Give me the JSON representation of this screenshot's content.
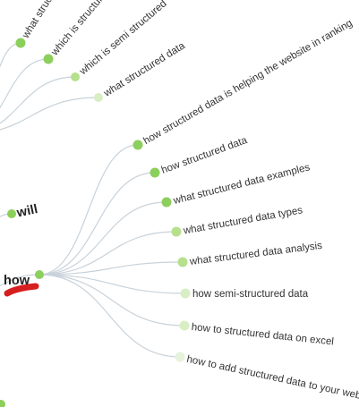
{
  "colors": {
    "node_strong": "#8ccf5c",
    "node_mid": "#b6e08c",
    "node_light": "#d8eec4",
    "node_faint": "#e6f2db",
    "link": "#c8d2da",
    "highlight": "#d61f1f"
  },
  "top_branch": {
    "leaves": [
      {
        "label": "what structured",
        "shade": "strong"
      },
      {
        "label": "which is structured",
        "shade": "strong"
      },
      {
        "label": "which is semi structured",
        "shade": "mid"
      },
      {
        "label": "what structured data",
        "shade": "light"
      }
    ]
  },
  "hubs": {
    "will": {
      "label": "will"
    },
    "how": {
      "label": "how",
      "highlighted": true
    }
  },
  "how_branch": {
    "leaves": [
      {
        "label": "how structured data is helping the website in ranking",
        "shade": "strong"
      },
      {
        "label": "how structured data",
        "shade": "strong"
      },
      {
        "label": "what structured data examples",
        "shade": "strong"
      },
      {
        "label": "what structured data types",
        "shade": "mid"
      },
      {
        "label": "what structured data analysis",
        "shade": "mid"
      },
      {
        "label": "how semi-structured data",
        "shade": "light"
      },
      {
        "label": "how to structured data on excel",
        "shade": "light"
      },
      {
        "label": "how to add structured data to your website",
        "shade": "faint"
      }
    ]
  }
}
